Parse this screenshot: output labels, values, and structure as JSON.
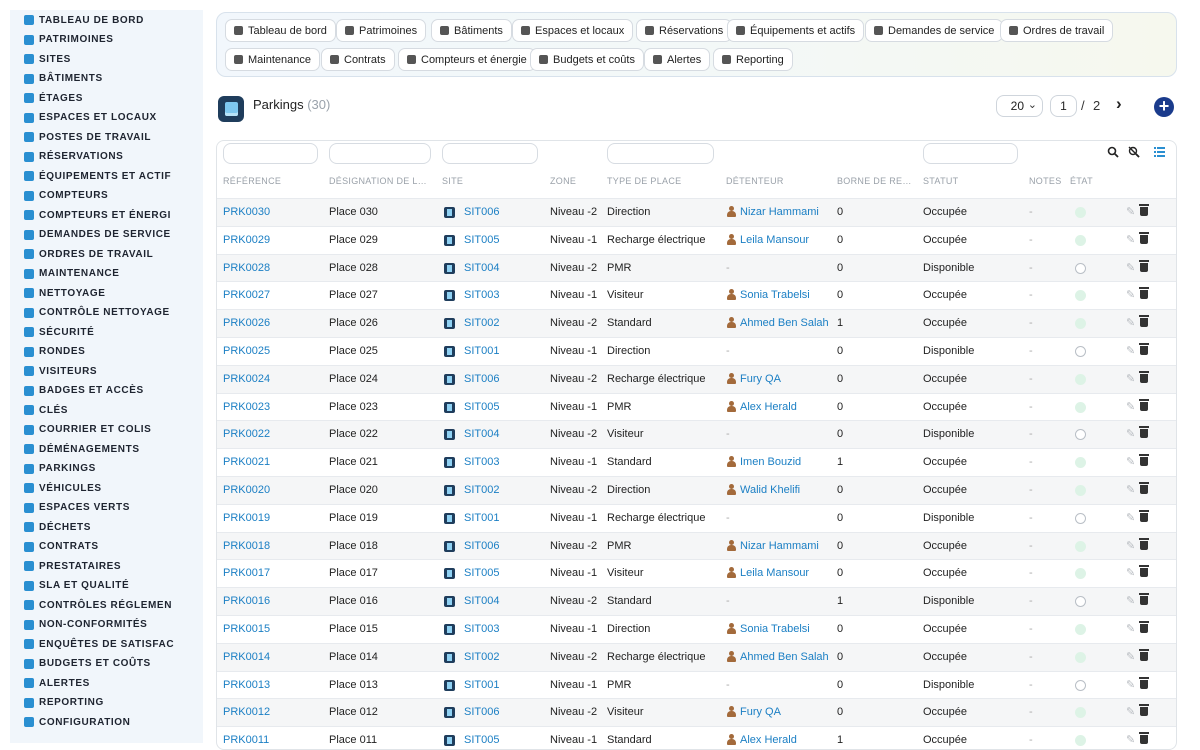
{
  "sidebar": {
    "items": [
      {
        "label": "TABLEAU DE BORD",
        "icon": "dashboard-icon"
      },
      {
        "label": "PATRIMOINES",
        "icon": "buildings-icon"
      },
      {
        "label": "SITES",
        "icon": "map-pin-icon"
      },
      {
        "label": "BÂTIMENTS",
        "icon": "building-icon"
      },
      {
        "label": "ÉTAGES",
        "icon": "layers-icon"
      },
      {
        "label": "ESPACES ET LOCAUX",
        "icon": "rooms-icon"
      },
      {
        "label": "POSTES DE TRAVAIL",
        "icon": "desktop-icon"
      },
      {
        "label": "RÉSERVATIONS",
        "icon": "calendar-icon"
      },
      {
        "label": "ÉQUIPEMENTS ET ACTIF",
        "icon": "cogs-icon"
      },
      {
        "label": "COMPTEURS",
        "icon": "database-icon"
      },
      {
        "label": "COMPTEURS ET ÉNERGI",
        "icon": "bolt-icon"
      },
      {
        "label": "DEMANDES DE SERVICE",
        "icon": "file-icon"
      },
      {
        "label": "ORDRES DE TRAVAIL",
        "icon": "tools-icon"
      },
      {
        "label": "MAINTENANCE",
        "icon": "wrench-icon"
      },
      {
        "label": "NETTOYAGE",
        "icon": "broom-icon"
      },
      {
        "label": "CONTRÔLE NETTOYAGE",
        "icon": "check-icon"
      },
      {
        "label": "SÉCURITÉ",
        "icon": "shield-icon"
      },
      {
        "label": "RONDES",
        "icon": "route-icon"
      },
      {
        "label": "VISITEURS",
        "icon": "id-card-icon"
      },
      {
        "label": "BADGES ET ACCÈS",
        "icon": "badge-icon"
      },
      {
        "label": "CLÉS",
        "icon": "key-icon"
      },
      {
        "label": "COURRIER ET COLIS",
        "icon": "mail-icon"
      },
      {
        "label": "DÉMÉNAGEMENTS",
        "icon": "dolly-icon"
      },
      {
        "label": "PARKINGS",
        "icon": "parking-icon"
      },
      {
        "label": "VÉHICULES",
        "icon": "car-icon"
      },
      {
        "label": "ESPACES VERTS",
        "icon": "leaf-icon"
      },
      {
        "label": "DÉCHETS",
        "icon": "recycle-icon"
      },
      {
        "label": "CONTRATS",
        "icon": "contract-icon"
      },
      {
        "label": "PRESTATAIRES",
        "icon": "handshake-icon"
      },
      {
        "label": "SLA ET QUALITÉ",
        "icon": "chart-icon"
      },
      {
        "label": "CONTRÔLES RÉGLEMEN",
        "icon": "clipboard-icon"
      },
      {
        "label": "NON-CONFORMITÉS",
        "icon": "alert-circle-icon"
      },
      {
        "label": "ENQUÊTES DE SATISFAC",
        "icon": "star-icon"
      },
      {
        "label": "BUDGETS ET COÛTS",
        "icon": "money-icon"
      },
      {
        "label": "ALERTES",
        "icon": "bell-icon"
      },
      {
        "label": "REPORTING",
        "icon": "pie-chart-icon"
      },
      {
        "label": "CONFIGURATION",
        "icon": "gear-icon"
      }
    ]
  },
  "navbar": {
    "buttons": [
      {
        "label": "Tableau de bord",
        "icon": "dashboard-icon"
      },
      {
        "label": "Patrimoines",
        "icon": "buildings-icon"
      },
      {
        "label": "Bâtiments",
        "icon": "building-icon"
      },
      {
        "label": "Espaces et locaux",
        "icon": "rooms-icon"
      },
      {
        "label": "Réservations",
        "icon": "calendar-icon"
      },
      {
        "label": "Équipements et actifs",
        "icon": "cogs-icon"
      },
      {
        "label": "Demandes de service",
        "icon": "file-icon"
      },
      {
        "label": "Ordres de travail",
        "icon": "tools-icon"
      },
      {
        "label": "Maintenance",
        "icon": "wrench-icon"
      },
      {
        "label": "Contrats",
        "icon": "contract-icon"
      },
      {
        "label": "Compteurs et énergie",
        "icon": "bolt-icon"
      },
      {
        "label": "Budgets et coûts",
        "icon": "money-icon"
      },
      {
        "label": "Alertes",
        "icon": "bell-icon"
      },
      {
        "label": "Reporting",
        "icon": "pie-chart-icon"
      }
    ]
  },
  "header": {
    "title": "Parkings",
    "count": "(30)",
    "page_size": "20",
    "current_page": "1",
    "page_separator": "/",
    "total_pages": "2",
    "next_symbol": "›",
    "add_symbol": "+"
  },
  "table": {
    "columns": [
      "RÉFÉRENCE",
      "DÉSIGNATION DE LA ...",
      "SITE",
      "ZONE",
      "TYPE DE PLACE",
      "DÉTENTEUR",
      "BORNE DE REC...",
      "STATUT",
      "NOTES",
      "ÉTAT"
    ],
    "rows": [
      {
        "ref": "PRK0030",
        "name": "Place 030",
        "site": "SIT006",
        "zone": "Niveau -2",
        "type": "Direction",
        "holder": "Nizar Hammami",
        "borne": "0",
        "status": "Occupée",
        "notes": "-",
        "state": "on"
      },
      {
        "ref": "PRK0029",
        "name": "Place 029",
        "site": "SIT005",
        "zone": "Niveau -1",
        "type": "Recharge électrique",
        "holder": "Leila Mansour",
        "borne": "0",
        "status": "Occupée",
        "notes": "-",
        "state": "on"
      },
      {
        "ref": "PRK0028",
        "name": "Place 028",
        "site": "SIT004",
        "zone": "Niveau -2",
        "type": "PMR",
        "holder": "-",
        "borne": "0",
        "status": "Disponible",
        "notes": "-",
        "state": "off"
      },
      {
        "ref": "PRK0027",
        "name": "Place 027",
        "site": "SIT003",
        "zone": "Niveau -1",
        "type": "Visiteur",
        "holder": "Sonia Trabelsi",
        "borne": "0",
        "status": "Occupée",
        "notes": "-",
        "state": "on"
      },
      {
        "ref": "PRK0026",
        "name": "Place 026",
        "site": "SIT002",
        "zone": "Niveau -2",
        "type": "Standard",
        "holder": "Ahmed Ben Salah",
        "borne": "1",
        "status": "Occupée",
        "notes": "-",
        "state": "on"
      },
      {
        "ref": "PRK0025",
        "name": "Place 025",
        "site": "SIT001",
        "zone": "Niveau -1",
        "type": "Direction",
        "holder": "-",
        "borne": "0",
        "status": "Disponible",
        "notes": "-",
        "state": "off"
      },
      {
        "ref": "PRK0024",
        "name": "Place 024",
        "site": "SIT006",
        "zone": "Niveau -2",
        "type": "Recharge électrique",
        "holder": "Fury QA",
        "borne": "0",
        "status": "Occupée",
        "notes": "-",
        "state": "on"
      },
      {
        "ref": "PRK0023",
        "name": "Place 023",
        "site": "SIT005",
        "zone": "Niveau -1",
        "type": "PMR",
        "holder": "Alex Herald",
        "borne": "0",
        "status": "Occupée",
        "notes": "-",
        "state": "on"
      },
      {
        "ref": "PRK0022",
        "name": "Place 022",
        "site": "SIT004",
        "zone": "Niveau -2",
        "type": "Visiteur",
        "holder": "-",
        "borne": "0",
        "status": "Disponible",
        "notes": "-",
        "state": "off"
      },
      {
        "ref": "PRK0021",
        "name": "Place 021",
        "site": "SIT003",
        "zone": "Niveau -1",
        "type": "Standard",
        "holder": "Imen Bouzid",
        "borne": "1",
        "status": "Occupée",
        "notes": "-",
        "state": "on"
      },
      {
        "ref": "PRK0020",
        "name": "Place 020",
        "site": "SIT002",
        "zone": "Niveau -2",
        "type": "Direction",
        "holder": "Walid Khelifi",
        "borne": "0",
        "status": "Occupée",
        "notes": "-",
        "state": "on"
      },
      {
        "ref": "PRK0019",
        "name": "Place 019",
        "site": "SIT001",
        "zone": "Niveau -1",
        "type": "Recharge électrique",
        "holder": "-",
        "borne": "0",
        "status": "Disponible",
        "notes": "-",
        "state": "off"
      },
      {
        "ref": "PRK0018",
        "name": "Place 018",
        "site": "SIT006",
        "zone": "Niveau -2",
        "type": "PMR",
        "holder": "Nizar Hammami",
        "borne": "0",
        "status": "Occupée",
        "notes": "-",
        "state": "on"
      },
      {
        "ref": "PRK0017",
        "name": "Place 017",
        "site": "SIT005",
        "zone": "Niveau -1",
        "type": "Visiteur",
        "holder": "Leila Mansour",
        "borne": "0",
        "status": "Occupée",
        "notes": "-",
        "state": "on"
      },
      {
        "ref": "PRK0016",
        "name": "Place 016",
        "site": "SIT004",
        "zone": "Niveau -2",
        "type": "Standard",
        "holder": "-",
        "borne": "1",
        "status": "Disponible",
        "notes": "-",
        "state": "off"
      },
      {
        "ref": "PRK0015",
        "name": "Place 015",
        "site": "SIT003",
        "zone": "Niveau -1",
        "type": "Direction",
        "holder": "Sonia Trabelsi",
        "borne": "0",
        "status": "Occupée",
        "notes": "-",
        "state": "on"
      },
      {
        "ref": "PRK0014",
        "name": "Place 014",
        "site": "SIT002",
        "zone": "Niveau -2",
        "type": "Recharge électrique",
        "holder": "Ahmed Ben Salah",
        "borne": "0",
        "status": "Occupée",
        "notes": "-",
        "state": "on"
      },
      {
        "ref": "PRK0013",
        "name": "Place 013",
        "site": "SIT001",
        "zone": "Niveau -1",
        "type": "PMR",
        "holder": "-",
        "borne": "0",
        "status": "Disponible",
        "notes": "-",
        "state": "off"
      },
      {
        "ref": "PRK0012",
        "name": "Place 012",
        "site": "SIT006",
        "zone": "Niveau -2",
        "type": "Visiteur",
        "holder": "Fury QA",
        "borne": "0",
        "status": "Occupée",
        "notes": "-",
        "state": "on"
      },
      {
        "ref": "PRK0011",
        "name": "Place 011",
        "site": "SIT005",
        "zone": "Niveau -1",
        "type": "Standard",
        "holder": "Alex Herald",
        "borne": "1",
        "status": "Occupée",
        "notes": "-",
        "state": "on"
      }
    ]
  },
  "colors": {
    "accent": "#1b7fc4",
    "sidebar_bg": "#f1f6fb",
    "add_button": "#1a3b8c",
    "active_state": "#ddf3e6"
  }
}
